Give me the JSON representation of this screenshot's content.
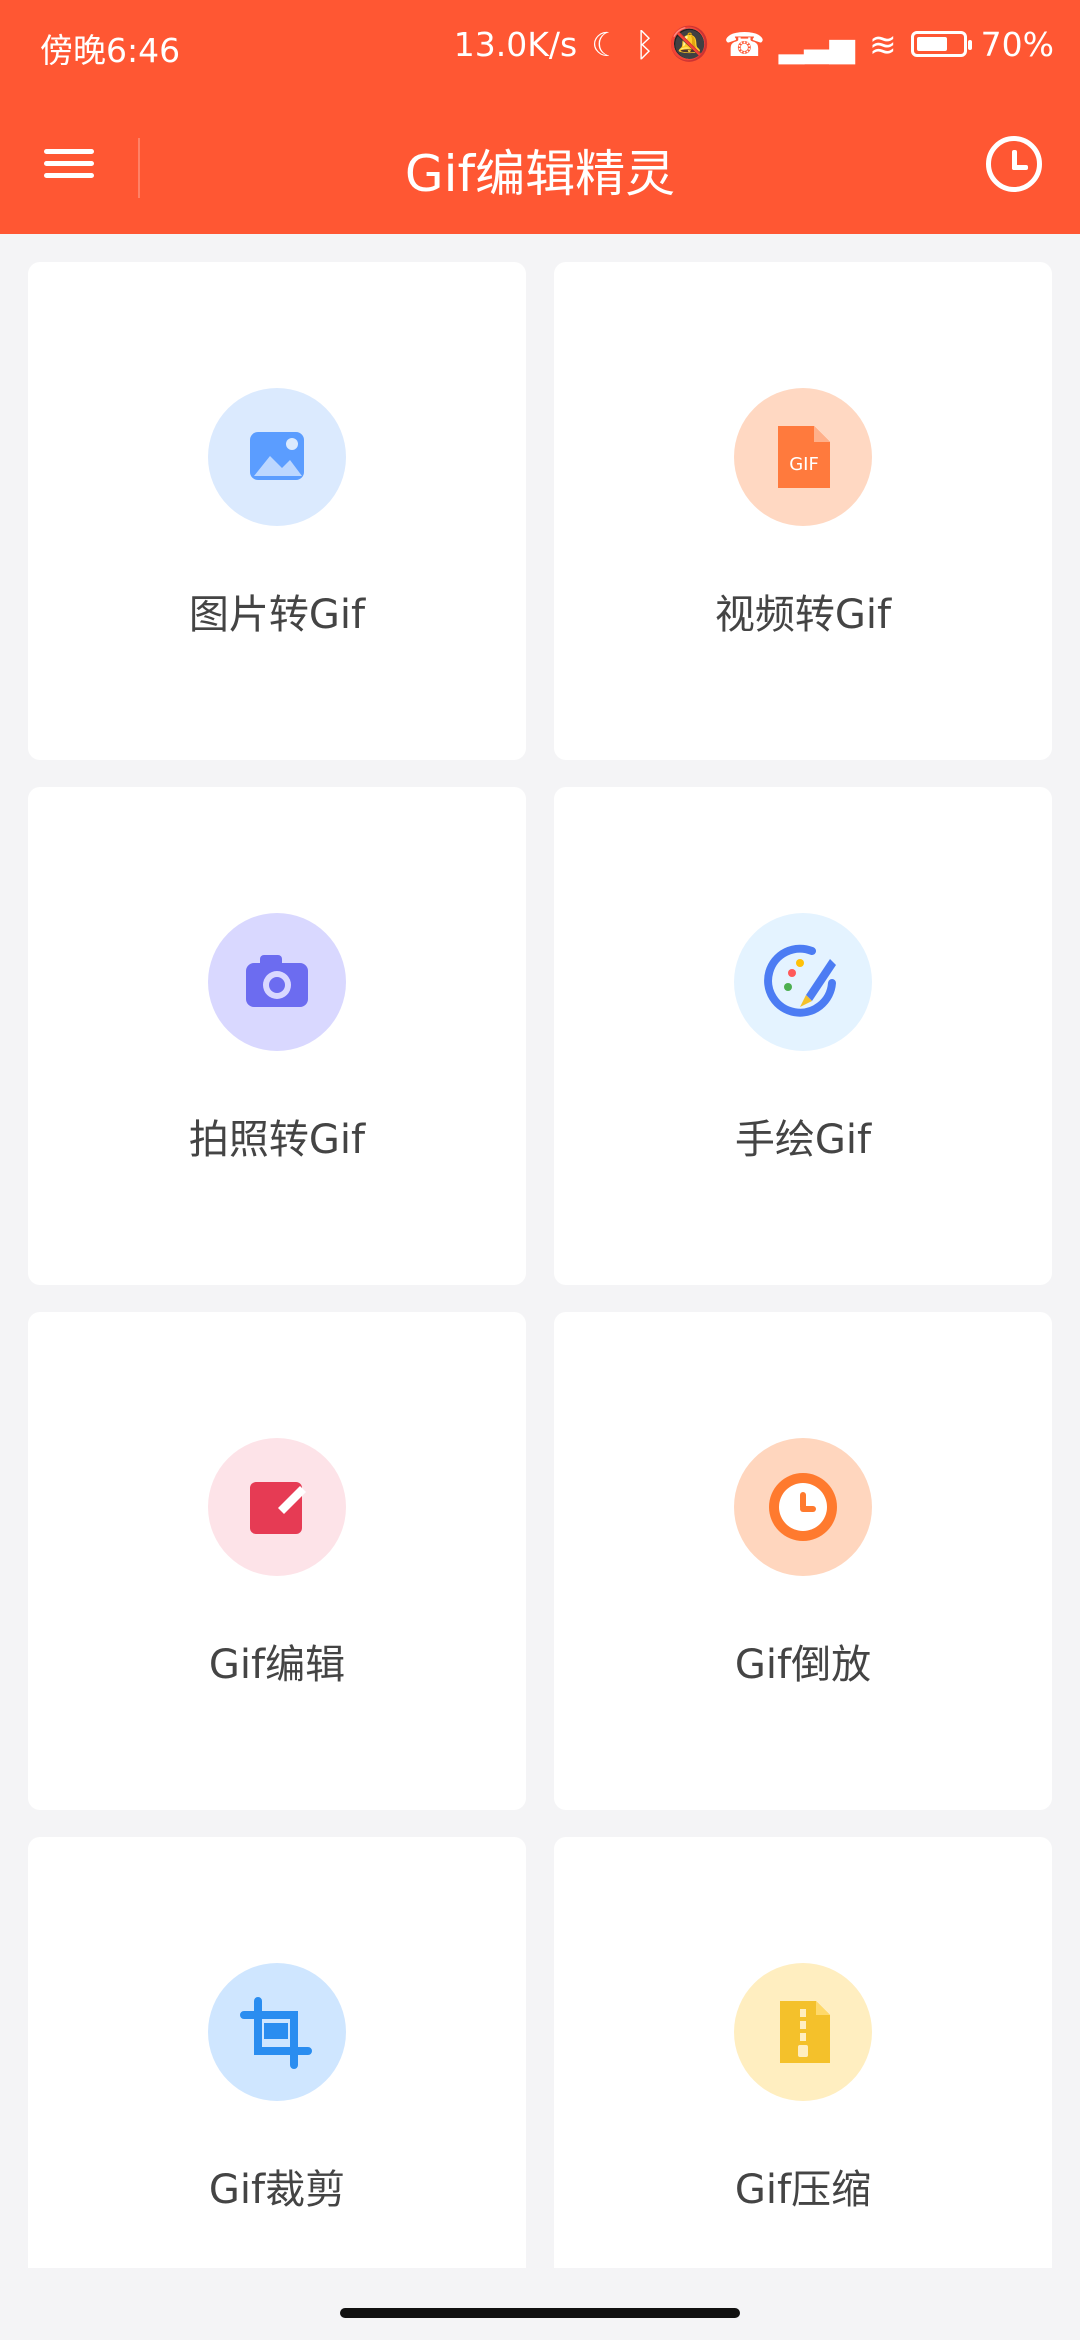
{
  "status": {
    "time": "傍晚6:46",
    "speed": "13.0K/s",
    "battery": "70%"
  },
  "appbar": {
    "title": "Gif编辑精灵"
  },
  "cards": [
    {
      "label": "图片转Gif",
      "icon": "image-icon",
      "bg": "#dbeafe",
      "fg": "#5b9dff"
    },
    {
      "label": "视频转Gif",
      "icon": "gif-file-icon",
      "bg": "#ffd8c2",
      "fg": "#ff7a3d"
    },
    {
      "label": "拍照转Gif",
      "icon": "camera-icon",
      "bg": "#d9d8ff",
      "fg": "#6c6cf0"
    },
    {
      "label": "手绘Gif",
      "icon": "palette-brush-icon",
      "bg": "#e4f3ff",
      "fg": "#4c7cf3"
    },
    {
      "label": "Gif编辑",
      "icon": "edit-note-icon",
      "bg": "#fde3e8",
      "fg": "#e63b54"
    },
    {
      "label": "Gif倒放",
      "icon": "clock-icon",
      "bg": "#ffd6be",
      "fg": "#ff7a2e"
    },
    {
      "label": "Gif裁剪",
      "icon": "crop-icon",
      "bg": "#cfe6ff",
      "fg": "#2a8df0"
    },
    {
      "label": "Gif压缩",
      "icon": "zip-icon",
      "bg": "#ffeec0",
      "fg": "#f4c12b"
    }
  ]
}
